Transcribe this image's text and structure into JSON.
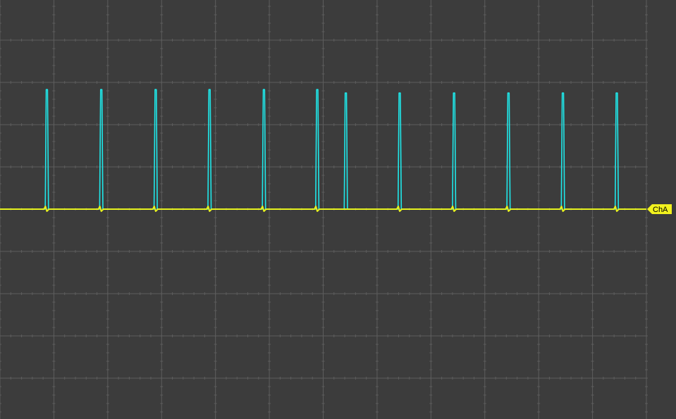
{
  "chart_data": {
    "type": "line",
    "title": "",
    "xlabel": "",
    "ylabel": "",
    "grid": true,
    "divisions": {
      "x": 12,
      "y": 10
    },
    "xlim": [
      0,
      12
    ],
    "ylim": [
      -5,
      5
    ],
    "series": [
      {
        "name": "",
        "color": "#1fe8ea",
        "baseline": 0,
        "pulse_width": 0.06,
        "pulses": [
          {
            "x": 0.87,
            "peak": 2.83
          },
          {
            "x": 1.88,
            "peak": 2.83
          },
          {
            "x": 2.89,
            "peak": 2.83
          },
          {
            "x": 3.89,
            "peak": 2.83
          },
          {
            "x": 4.9,
            "peak": 2.83
          },
          {
            "x": 5.89,
            "peak": 2.83
          },
          {
            "x": 6.42,
            "peak": 2.75
          },
          {
            "x": 7.42,
            "peak": 2.75
          },
          {
            "x": 8.43,
            "peak": 2.75
          },
          {
            "x": 9.44,
            "peak": 2.75
          },
          {
            "x": 10.45,
            "peak": 2.75
          },
          {
            "x": 11.45,
            "peak": 2.75
          }
        ]
      },
      {
        "name": "ChA",
        "color": "#e6f21e",
        "baseline": 0,
        "glitches": [
          0.87,
          1.88,
          2.89,
          3.89,
          4.9,
          5.89,
          7.42,
          8.43,
          9.44,
          10.45,
          11.45
        ]
      }
    ],
    "markers": [
      {
        "label": "ChA",
        "channel": "ChA",
        "level": 0,
        "color": "#f2f21e"
      }
    ]
  }
}
